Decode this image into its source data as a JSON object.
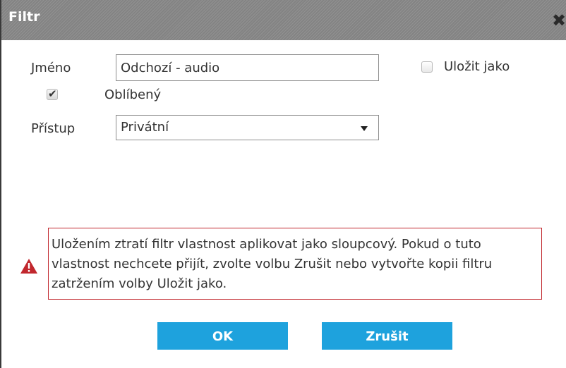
{
  "dialog": {
    "title": "Filtr",
    "close_glyph": "✖"
  },
  "form": {
    "name_label": "Jméno",
    "name_value": "Odchozí - audio",
    "save_as_label": "Uložit jako",
    "save_as_checked": false,
    "favorite_label": "Oblíbený",
    "favorite_checked": true,
    "access_label": "Přístup",
    "access_value": "Privátní"
  },
  "warning": {
    "icon": "warning-triangle-icon",
    "color": "#c1272d",
    "text": "Uložením ztratí filtr vlastnost aplikovat jako sloupcový. Pokud o tuto vlastnost nechcete přijít, zvolte volbu Zrušit nebo vytvořte kopii filtru zatržením volby Uložit jako."
  },
  "buttons": {
    "ok_label": "OK",
    "cancel_label": "Zrušit",
    "color": "#1ea2dd"
  }
}
